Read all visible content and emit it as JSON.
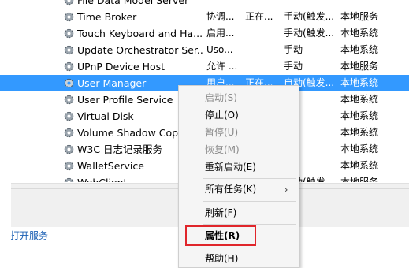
{
  "services": [
    {
      "name": "File Data Model Server",
      "desc": "",
      "status": "",
      "startup": "",
      "logon": "",
      "selected": false
    },
    {
      "name": "Time Broker",
      "desc": "协调...",
      "status": "正在...",
      "startup": "手动(触发...",
      "logon": "本地服务",
      "selected": false
    },
    {
      "name": "Touch Keyboard and Ha...",
      "desc": "启用...",
      "status": "",
      "startup": "手动(触发...",
      "logon": "本地系统",
      "selected": false
    },
    {
      "name": "Update Orchestrator Ser...",
      "desc": "Uso...",
      "status": "",
      "startup": "手动",
      "logon": "本地系统",
      "selected": false
    },
    {
      "name": "UPnP Device Host",
      "desc": "允许 ...",
      "status": "",
      "startup": "手动",
      "logon": "本地服务",
      "selected": false
    },
    {
      "name": "User Manager",
      "desc": "用户...",
      "status": "正在...",
      "startup": "自动(触发...",
      "logon": "本地系统",
      "selected": true
    },
    {
      "name": "User Profile Service",
      "desc": "",
      "status": "",
      "startup": "",
      "logon": "本地系统",
      "selected": false
    },
    {
      "name": "Virtual Disk",
      "desc": "",
      "status": "",
      "startup": "",
      "logon": "本地系统",
      "selected": false
    },
    {
      "name": "Volume Shadow Copy",
      "desc": "",
      "status": "",
      "startup": "",
      "logon": "本地系统",
      "selected": false
    },
    {
      "name": "W3C 日志记录服务",
      "desc": "",
      "status": "",
      "startup": "",
      "logon": "本地系统",
      "selected": false
    },
    {
      "name": "WalletService",
      "desc": "",
      "status": "",
      "startup": "",
      "logon": "本地系统",
      "selected": false
    },
    {
      "name": "WebClient",
      "desc": "",
      "status": "",
      "startup": "手动(触发...",
      "logon": "本地服务",
      "selected": false
    }
  ],
  "context_menu": {
    "start": "启动(S)",
    "stop": "停止(O)",
    "pause": "暂停(U)",
    "resume": "恢复(M)",
    "restart": "重新启动(E)",
    "all_tasks": "所有任务(K)",
    "all_tasks_arrow": "›",
    "refresh": "刷新(F)",
    "properties": "属性(R)",
    "help": "帮助(H)"
  },
  "bottom_link": "打开服务",
  "colors": {
    "selection": "#3399ff",
    "highlight_box": "#e0262b",
    "link": "#1a5fb4"
  }
}
